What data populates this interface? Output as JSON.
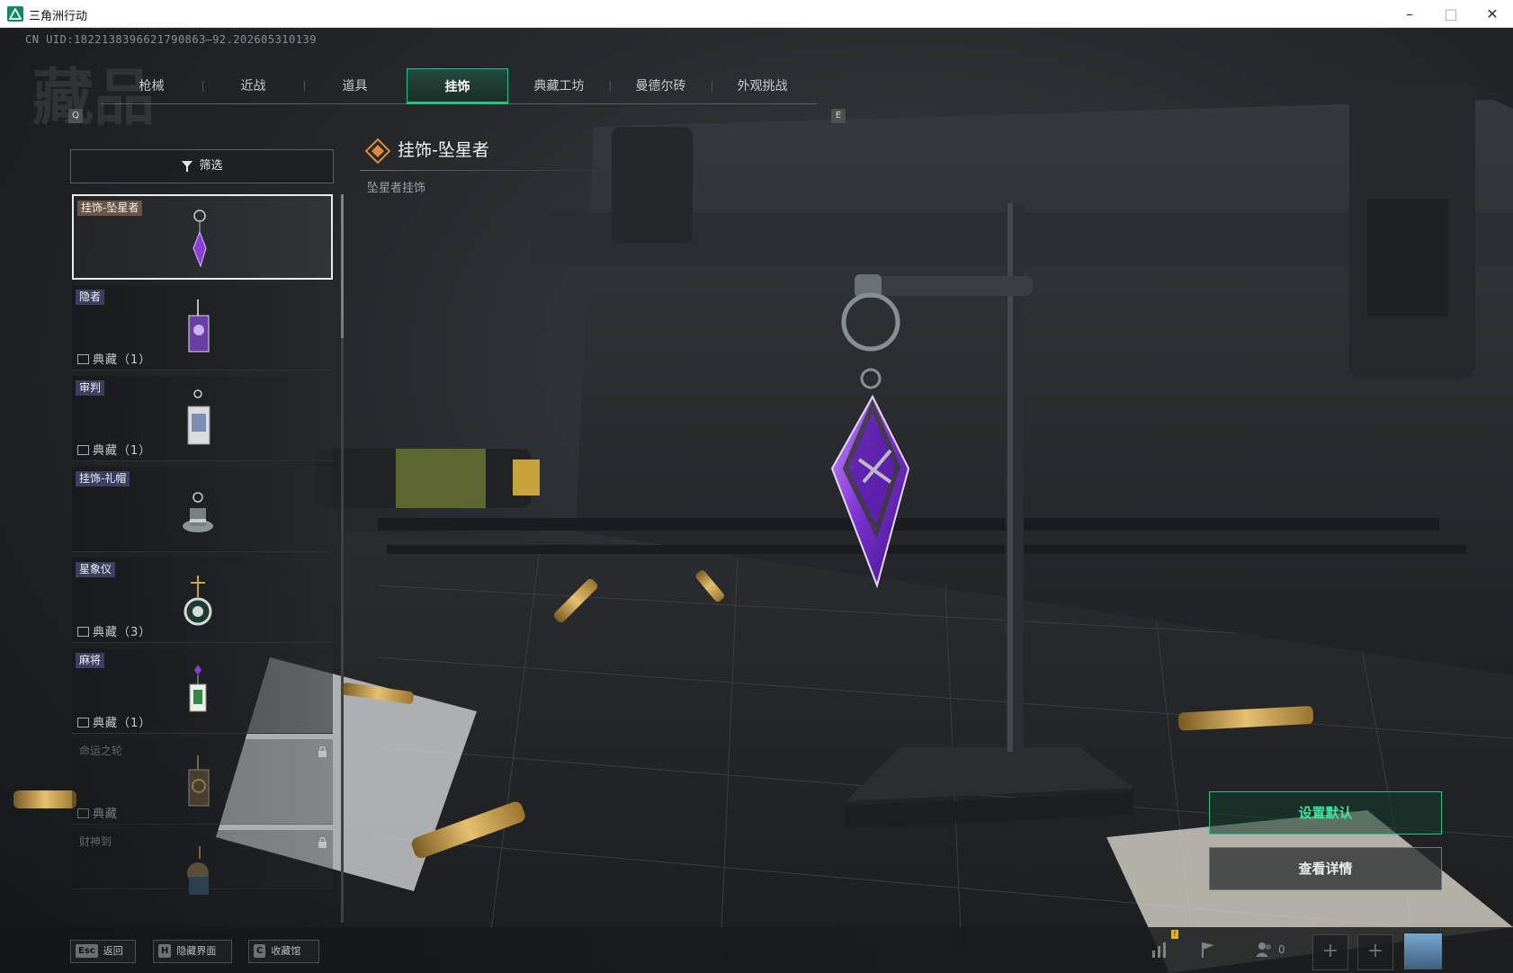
{
  "window": {
    "title": "三角洲行动"
  },
  "uid_text": "CN UID:1822138396621790863̶92.202605310139",
  "watermark": "藏品",
  "tabs": {
    "left_key": "Q",
    "right_key": "E",
    "items": [
      {
        "label": "枪械",
        "active": false
      },
      {
        "label": "近战",
        "active": false
      },
      {
        "label": "道具",
        "active": false
      },
      {
        "label": "挂饰",
        "active": true
      },
      {
        "label": "典藏工坊",
        "active": false
      },
      {
        "label": "曼德尔砖",
        "active": false
      },
      {
        "label": "外观挑战",
        "active": false
      }
    ]
  },
  "filter": {
    "label": "筛选"
  },
  "items": [
    {
      "tag": "挂饰-坠星者",
      "collection": "",
      "selected": true,
      "locked": false,
      "icon": "star-faller-charm"
    },
    {
      "tag": "隐者",
      "collection": "典藏（1）",
      "selected": false,
      "locked": false,
      "icon": "hermit-card-charm"
    },
    {
      "tag": "审判",
      "collection": "典藏（1）",
      "selected": false,
      "locked": false,
      "icon": "judgment-card-charm"
    },
    {
      "tag": "挂饰-礼帽",
      "collection": "",
      "selected": false,
      "locked": false,
      "icon": "top-hat-charm"
    },
    {
      "tag": "星象仪",
      "collection": "典藏（3）",
      "selected": false,
      "locked": false,
      "icon": "astrolabe-charm"
    },
    {
      "tag": "麻将",
      "collection": "典藏（1）",
      "selected": false,
      "locked": false,
      "icon": "mahjong-charm"
    },
    {
      "tag": "命运之轮",
      "collection": "典藏",
      "selected": false,
      "locked": true,
      "icon": "wheel-of-fortune-charm"
    },
    {
      "tag": "财神到",
      "collection": "",
      "selected": false,
      "locked": true,
      "icon": "god-of-wealth-charm"
    }
  ],
  "detail": {
    "title": "挂饰-坠星者",
    "subtitle": "坠星者挂饰"
  },
  "actions": {
    "set_default": "设置默认",
    "view_details": "查看详情"
  },
  "bottom": {
    "hints": [
      {
        "key": "Esc",
        "label": "返回"
      },
      {
        "key": "H",
        "label": "隐藏界面"
      },
      {
        "key": "C",
        "label": "收藏馆"
      }
    ],
    "friends_count": "0",
    "badge": "!"
  },
  "colors": {
    "accent": "#1fc586",
    "charm_purple": "#8b3fd6"
  }
}
